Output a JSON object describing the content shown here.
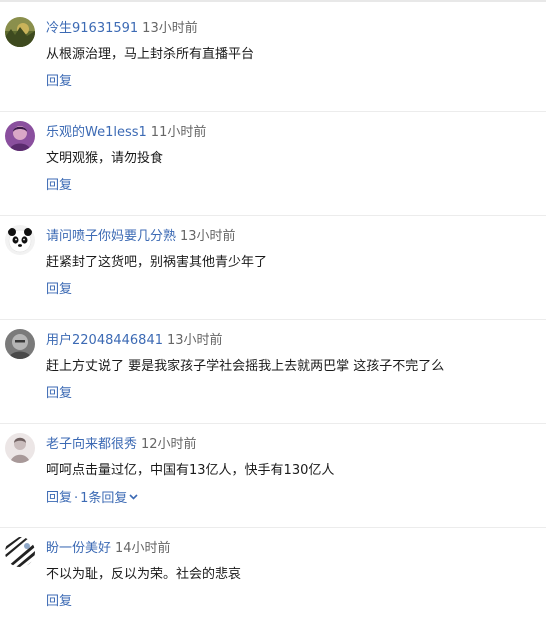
{
  "comments": [
    {
      "username": "冷生91631591",
      "time": "13小时前",
      "text": "从根源治理，马上封杀所有直播平台",
      "reply_label": "回复",
      "avatar_icon": "grass-photo-avatar-icon"
    },
    {
      "username": "乐观的We1less1",
      "time": "11小时前",
      "text": "文明观猴，请勿投食",
      "reply_label": "回复",
      "avatar_icon": "purple-portrait-avatar-icon"
    },
    {
      "username": "请问喷子你妈要几分熟",
      "time": "13小时前",
      "text": "赶紧封了这货吧，别祸害其他青少年了",
      "reply_label": "回复",
      "avatar_icon": "panda-avatar-icon"
    },
    {
      "username": "用户22048446841",
      "time": "13小时前",
      "text": "赶上方丈说了 要是我家孩子学社会摇我上去就两巴掌 这孩子不完了么",
      "reply_label": "回复",
      "avatar_icon": "gray-face-avatar-icon"
    },
    {
      "username": "老子向来都很秀",
      "time": "12小时前",
      "text": "呵呵点击量过亿，中国有13亿人，快手有130亿人",
      "reply_label": "回复",
      "separator": "·",
      "more_replies_label": "1条回复",
      "avatar_icon": "light-figure-avatar-icon"
    },
    {
      "username": "盼一份美好",
      "time": "14小时前",
      "text": "不以为耻，反以为荣。社会的悲哀",
      "reply_label": "回复",
      "avatar_icon": "zebra-avatar-icon"
    }
  ],
  "colors": {
    "link": "#3c6ab4",
    "text": "#1a1a1a",
    "time": "#666666",
    "divider": "#ececec"
  }
}
